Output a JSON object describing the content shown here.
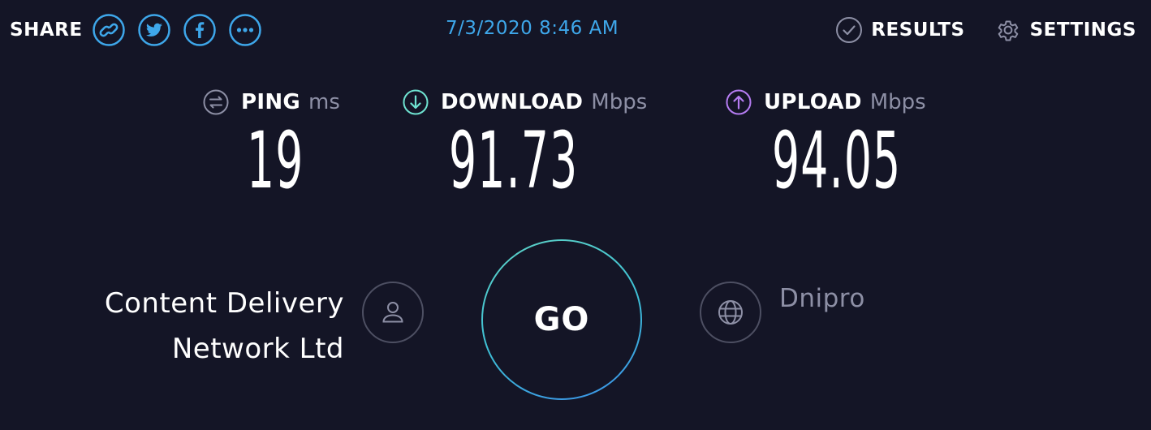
{
  "header": {
    "share_label": "SHARE",
    "share_buttons": [
      {
        "icon": "link-icon"
      },
      {
        "icon": "twitter-icon"
      },
      {
        "icon": "facebook-icon"
      },
      {
        "icon": "more-icon"
      }
    ],
    "datetime": "7/3/2020 8:46 AM",
    "results_label": "RESULTS",
    "settings_label": "SETTINGS"
  },
  "metrics": {
    "ping": {
      "label": "PING",
      "unit": "ms",
      "value": "19",
      "icon": "ping-icon",
      "icon_color": "#8d8fa5"
    },
    "download": {
      "label": "DOWNLOAD",
      "unit": "Mbps",
      "value": "91.73",
      "icon": "download-icon",
      "icon_color": "#6fe3d1"
    },
    "upload": {
      "label": "UPLOAD",
      "unit": "Mbps",
      "value": "94.05",
      "icon": "upload-icon",
      "icon_color": "#b57cf2"
    }
  },
  "provider": {
    "line1": "Content Delivery",
    "line2": "Network Ltd",
    "icon": "user-icon"
  },
  "go_label": "GO",
  "server": {
    "name": "Dnipro",
    "icon": "globe-icon"
  },
  "colors": {
    "background": "#141526",
    "accent_blue": "#3ea7ea",
    "muted": "#8d8fa5"
  }
}
